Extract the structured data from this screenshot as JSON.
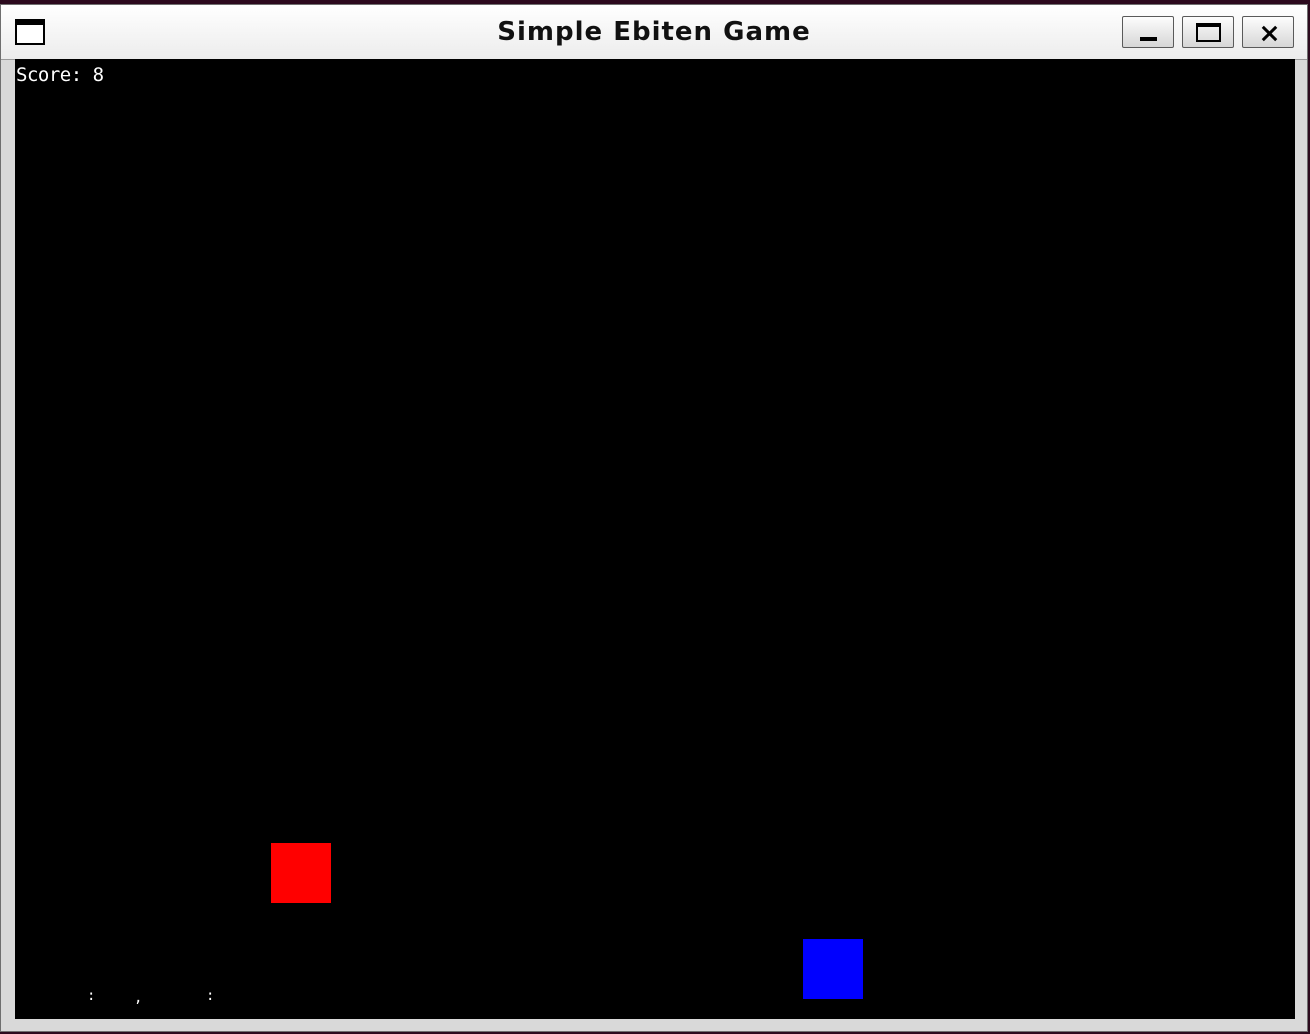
{
  "window": {
    "title": "Simple Ebiten Game",
    "icon": "window-menu-icon",
    "controls": {
      "minimize": "minimize-icon",
      "maximize": "maximize-icon",
      "close": "close-icon"
    }
  },
  "game": {
    "background_color": "#000000",
    "score_text": "Score: 8",
    "player": {
      "color": "#ff0000"
    },
    "enemy": {
      "color": "#0000ff"
    },
    "debug_marks": [
      ":",
      ",",
      ":"
    ]
  }
}
